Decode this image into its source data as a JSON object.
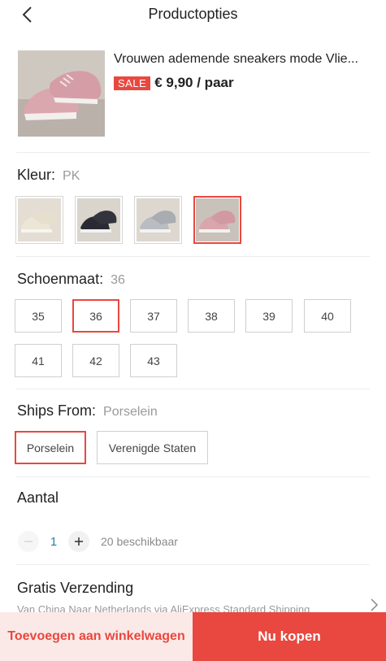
{
  "header": {
    "title": "Productopties"
  },
  "product": {
    "title": "Vrouwen ademende sneakers mode Vlie...",
    "sale_badge": "SALE",
    "price": "€ 9,90 / paar"
  },
  "color": {
    "label": "Kleur:",
    "selected": "PK",
    "options": [
      {
        "name": "beige",
        "upper": "#ece6d6",
        "sole": "#f7f5ef"
      },
      {
        "name": "black",
        "upper": "#2a2a33",
        "sole": "#f2f2f2"
      },
      {
        "name": "grey",
        "upper": "#b9bcc0",
        "sole": "#f2f2f2"
      },
      {
        "name": "pink",
        "upper": "#d9a6ac",
        "sole": "#f4f1ef"
      }
    ],
    "selected_index": 3
  },
  "size": {
    "label": "Schoenmaat:",
    "selected": "36",
    "options": [
      "35",
      "36",
      "37",
      "38",
      "39",
      "40",
      "41",
      "42",
      "43"
    ]
  },
  "ships_from": {
    "label": "Ships From:",
    "selected": "Porselein",
    "options": [
      "Porselein",
      "Verenigde Staten"
    ]
  },
  "quantity": {
    "label": "Aantal",
    "value": "1",
    "available": "20 beschikbaar"
  },
  "shipping": {
    "title": "Gratis Verzending",
    "description": "Van China Naar Netherlands via AliExpress Standard Shipping"
  },
  "actions": {
    "add_to_cart": "Toevoegen aan winkelwagen",
    "buy_now": "Nu kopen"
  },
  "colors": {
    "accent": "#e8483f",
    "accent_light": "#fbe9e8"
  }
}
